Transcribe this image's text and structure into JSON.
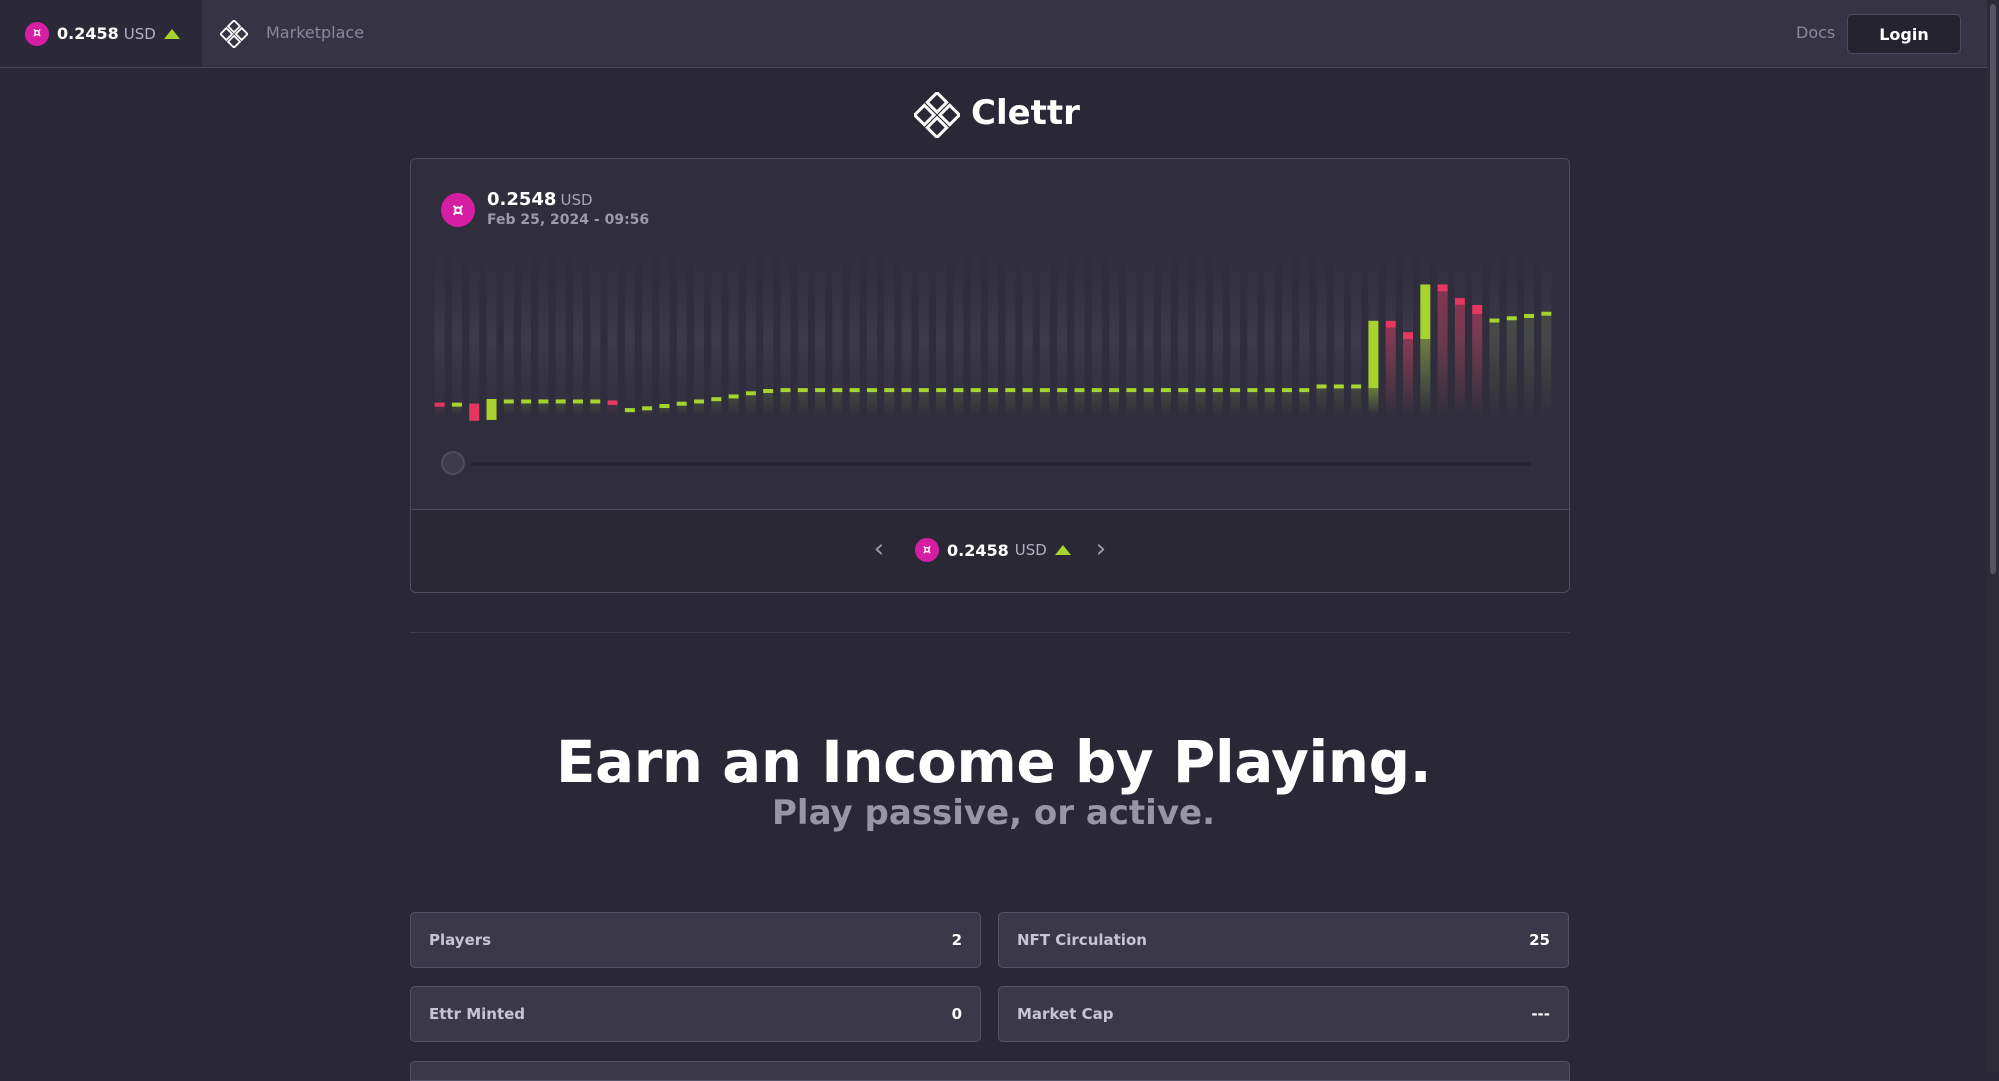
{
  "topbar": {
    "price": "0.2458",
    "unit": "USD",
    "marketplace_label": "Marketplace",
    "docs_label": "Docs",
    "login_label": "Login"
  },
  "brand": {
    "name": "Clettr"
  },
  "chart_card": {
    "price": "0.2548",
    "unit": "USD",
    "date": "Feb 25, 2024 - 09:56",
    "pager_price": "0.2458",
    "pager_unit": "USD"
  },
  "colors": {
    "up": "#a6d32d",
    "down": "#e5375f",
    "coin": "#d61ea3",
    "background": "#2a2836"
  },
  "icons": {
    "coin": "clettr-coin-icon",
    "logo": "clettr-diamond-logo-icon",
    "trend": "triangle-up-icon",
    "prev": "chevron-left-icon",
    "next": "chevron-right-icon"
  },
  "chart_data": {
    "type": "candlestick",
    "candles": [
      {
        "o": 0.212,
        "c": 0.2118
      },
      {
        "o": 0.2118,
        "c": 0.212
      },
      {
        "o": 0.2118,
        "c": 0.208
      },
      {
        "o": 0.2082,
        "c": 0.2128
      },
      {
        "o": 0.2125,
        "c": 0.2127
      },
      {
        "o": 0.2125,
        "c": 0.2127
      },
      {
        "o": 0.2125,
        "c": 0.2127
      },
      {
        "o": 0.2125,
        "c": 0.2127
      },
      {
        "o": 0.2125,
        "c": 0.2127
      },
      {
        "o": 0.2125,
        "c": 0.2127
      },
      {
        "o": 0.2125,
        "c": 0.2115
      },
      {
        "o": 0.2105,
        "c": 0.2108
      },
      {
        "o": 0.2108,
        "c": 0.2112
      },
      {
        "o": 0.2112,
        "c": 0.2117
      },
      {
        "o": 0.2117,
        "c": 0.2122
      },
      {
        "o": 0.2122,
        "c": 0.2127
      },
      {
        "o": 0.2127,
        "c": 0.2132
      },
      {
        "o": 0.2132,
        "c": 0.2138
      },
      {
        "o": 0.2138,
        "c": 0.2145
      },
      {
        "o": 0.2145,
        "c": 0.215
      },
      {
        "o": 0.215,
        "c": 0.2152
      },
      {
        "o": 0.215,
        "c": 0.2152
      },
      {
        "o": 0.215,
        "c": 0.2152
      },
      {
        "o": 0.215,
        "c": 0.2152
      },
      {
        "o": 0.215,
        "c": 0.2152
      },
      {
        "o": 0.215,
        "c": 0.2152
      },
      {
        "o": 0.215,
        "c": 0.2152
      },
      {
        "o": 0.215,
        "c": 0.2152
      },
      {
        "o": 0.215,
        "c": 0.2152
      },
      {
        "o": 0.215,
        "c": 0.2152
      },
      {
        "o": 0.215,
        "c": 0.2152
      },
      {
        "o": 0.215,
        "c": 0.2152
      },
      {
        "o": 0.215,
        "c": 0.2152
      },
      {
        "o": 0.215,
        "c": 0.2152
      },
      {
        "o": 0.215,
        "c": 0.2152
      },
      {
        "o": 0.215,
        "c": 0.2152
      },
      {
        "o": 0.215,
        "c": 0.2152
      },
      {
        "o": 0.215,
        "c": 0.2152
      },
      {
        "o": 0.215,
        "c": 0.2152
      },
      {
        "o": 0.215,
        "c": 0.2152
      },
      {
        "o": 0.215,
        "c": 0.2152
      },
      {
        "o": 0.215,
        "c": 0.2152
      },
      {
        "o": 0.215,
        "c": 0.2152
      },
      {
        "o": 0.215,
        "c": 0.2152
      },
      {
        "o": 0.215,
        "c": 0.2152
      },
      {
        "o": 0.215,
        "c": 0.2152
      },
      {
        "o": 0.215,
        "c": 0.2152
      },
      {
        "o": 0.215,
        "c": 0.2152
      },
      {
        "o": 0.215,
        "c": 0.2152
      },
      {
        "o": 0.215,
        "c": 0.2152
      },
      {
        "o": 0.215,
        "c": 0.2152
      },
      {
        "o": 0.2152,
        "c": 0.216
      },
      {
        "o": 0.216,
        "c": 0.216
      },
      {
        "o": 0.216,
        "c": 0.216
      },
      {
        "o": 0.2152,
        "c": 0.23
      },
      {
        "o": 0.23,
        "c": 0.2285
      },
      {
        "o": 0.2275,
        "c": 0.226
      },
      {
        "o": 0.226,
        "c": 0.238
      },
      {
        "o": 0.238,
        "c": 0.2365
      },
      {
        "o": 0.235,
        "c": 0.2335
      },
      {
        "o": 0.2335,
        "c": 0.2315
      },
      {
        "o": 0.23,
        "c": 0.2305
      },
      {
        "o": 0.2305,
        "c": 0.231
      },
      {
        "o": 0.231,
        "c": 0.2315
      },
      {
        "o": 0.2315,
        "c": 0.232
      }
    ],
    "ylim": [
      0.204,
      0.248
    ]
  },
  "stats": {
    "players_label": "Players",
    "players_value": "2",
    "nft_label": "NFT Circulation",
    "nft_value": "25",
    "ettr_label": "Ettr Minted",
    "ettr_value": "0",
    "mcap_label": "Market Cap",
    "mcap_value": "---"
  },
  "hero": {
    "title": "Earn an Income by Playing.",
    "subtitle": "Play passive, or active."
  }
}
